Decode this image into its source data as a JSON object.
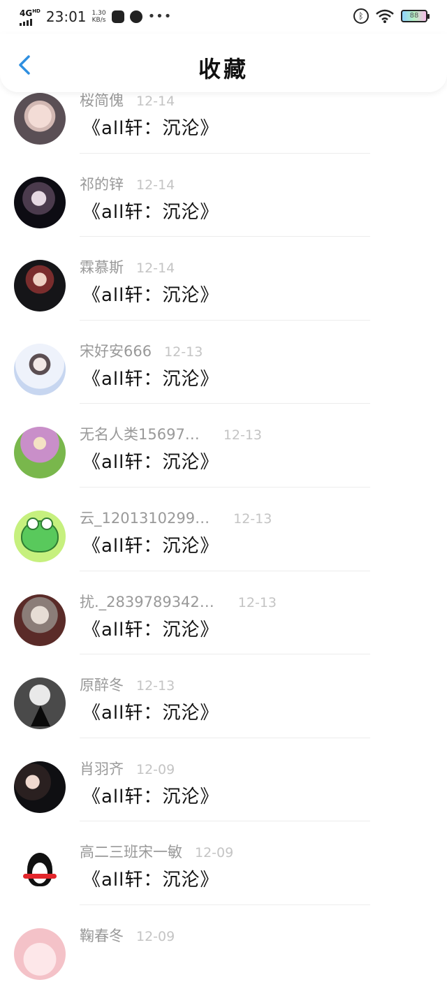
{
  "status_bar": {
    "network": "4G",
    "network_sup": "HD",
    "time": "23:01",
    "speed_value": "1.30",
    "speed_unit": "KB/s",
    "battery": "88"
  },
  "header": {
    "title": "收藏",
    "back_icon": "chevron-left-icon",
    "accent_color": "#2f8fe0"
  },
  "items": [
    {
      "name": "桜简傀",
      "date": "12-14",
      "text": "《all轩：沉沦》"
    },
    {
      "name": "祁的锌",
      "date": "12-14",
      "text": "《all轩：沉沦》"
    },
    {
      "name": "霖慕斯",
      "date": "12-14",
      "text": "《all轩：沉沦》"
    },
    {
      "name": "宋好安666",
      "date": "12-13",
      "text": "《all轩：沉沦》"
    },
    {
      "name": "无名人类15697…",
      "date": "12-13",
      "text": "《all轩：沉沦》"
    },
    {
      "name": "云_1201310299…",
      "date": "12-13",
      "text": "《all轩：沉沦》"
    },
    {
      "name": "扰._2839789342…",
      "date": "12-13",
      "text": "《all轩：沉沦》"
    },
    {
      "name": "原醉冬",
      "date": "12-13",
      "text": "《all轩：沉沦》"
    },
    {
      "name": "肖羽齐",
      "date": "12-09",
      "text": "《all轩：沉沦》"
    },
    {
      "name": "高二三班宋一敏",
      "date": "12-09",
      "text": "《all轩：沉沦》"
    },
    {
      "name": "鞠春冬",
      "date": "12-09",
      "text": ""
    }
  ]
}
